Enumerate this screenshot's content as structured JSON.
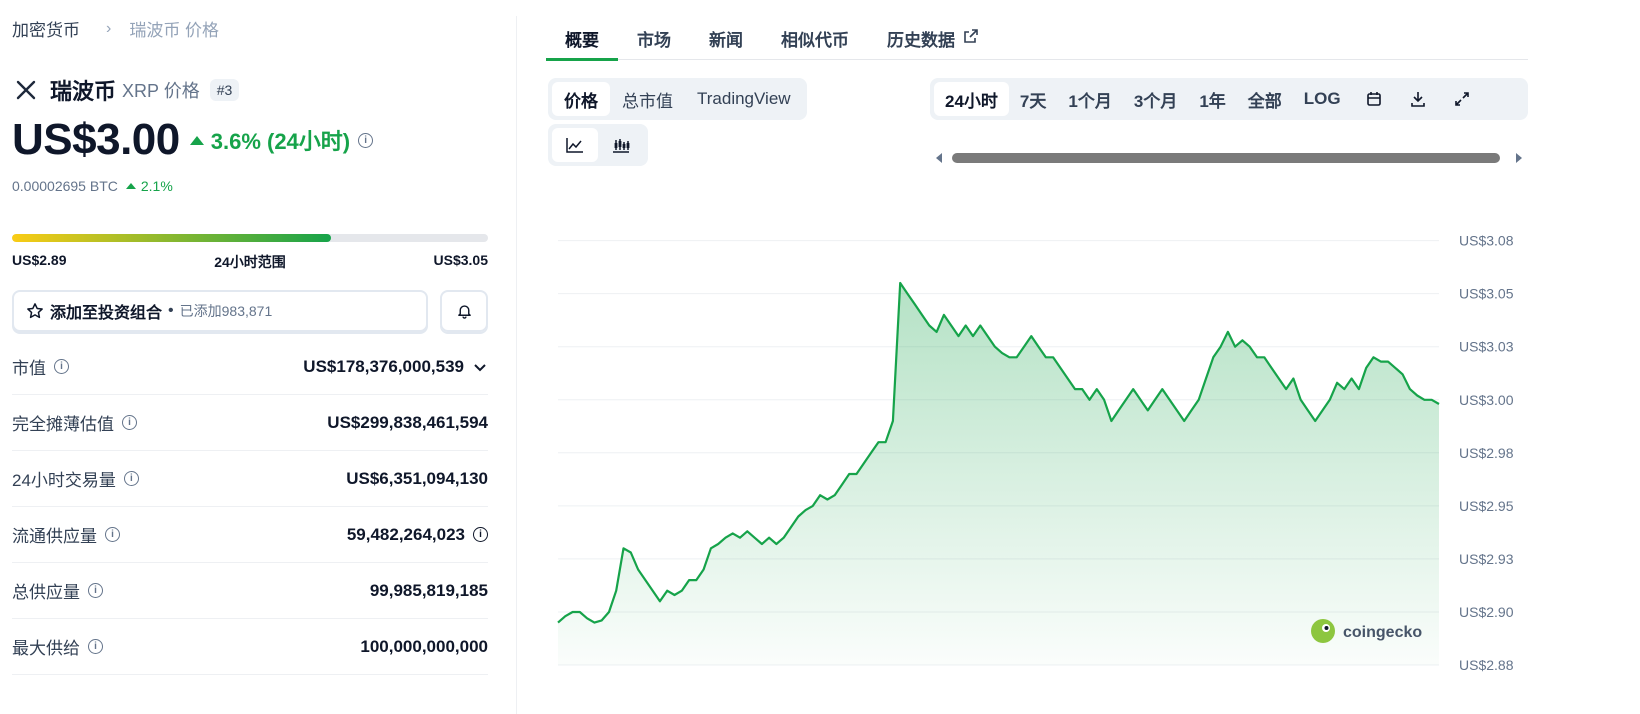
{
  "breadcrumb": {
    "parent": "加密货币",
    "current": "瑞波币 价格"
  },
  "coin": {
    "name": "瑞波币",
    "symbol": "XRP 价格",
    "rank": "#3"
  },
  "price": {
    "value": "US$3.00",
    "change": "3.6% (24小时)",
    "btc": "0.00002695 BTC",
    "btc_change": "2.1%"
  },
  "range": {
    "low": "US$2.89",
    "label": "24小时范围",
    "high": "US$3.05",
    "position_fraction": 0.67
  },
  "portfolio": {
    "label": "添加至投资组合",
    "dot": "•",
    "count": "已添加983,871"
  },
  "stats": [
    {
      "key": "市值",
      "value": "US$178,376,000,539"
    },
    {
      "key": "完全摊薄估值",
      "value": "US$299,838,461,594"
    },
    {
      "key": "24小时交易量",
      "value": "US$6,351,094,130"
    },
    {
      "key": "流通供应量",
      "value": "59,482,264,023"
    },
    {
      "key": "总供应量",
      "value": "99,985,819,185"
    },
    {
      "key": "最大供给",
      "value": "100,000,000,000"
    }
  ],
  "tabs": [
    "概要",
    "市场",
    "新闻",
    "相似代币",
    "历史数据"
  ],
  "chart_type_tabs": [
    "价格",
    "总市值",
    "TradingView"
  ],
  "time_ranges": [
    "24小时",
    "7天",
    "1个月",
    "3个月",
    "1年",
    "全部",
    "LOG"
  ],
  "colors": {
    "accent": "#16a34a",
    "range_start": "#facc15"
  },
  "chart_data": {
    "type": "area",
    "title": "",
    "xlabel": "",
    "ylabel": "",
    "y_ticks": [
      "US$3.08",
      "US$3.05",
      "US$3.03",
      "US$3.00",
      "US$2.98",
      "US$2.95",
      "US$2.93",
      "US$2.90",
      "US$2.88"
    ],
    "ylim": [
      2.875,
      3.08
    ],
    "grid": true,
    "brand": "coingecko",
    "series": [
      {
        "values": [
          2.895,
          2.898,
          2.9,
          2.9,
          2.897,
          2.895,
          2.896,
          2.9,
          2.91,
          2.93,
          2.928,
          2.92,
          2.915,
          2.91,
          2.905,
          2.91,
          2.908,
          2.91,
          2.915,
          2.915,
          2.92,
          2.93,
          2.932,
          2.935,
          2.937,
          2.935,
          2.938,
          2.935,
          2.932,
          2.935,
          2.932,
          2.935,
          2.94,
          2.945,
          2.948,
          2.95,
          2.955,
          2.953,
          2.955,
          2.96,
          2.965,
          2.965,
          2.97,
          2.975,
          2.98,
          2.98,
          2.99,
          3.055,
          3.05,
          3.045,
          3.04,
          3.035,
          3.032,
          3.04,
          3.035,
          3.03,
          3.035,
          3.03,
          3.035,
          3.03,
          3.025,
          3.022,
          3.02,
          3.02,
          3.025,
          3.03,
          3.025,
          3.02,
          3.02,
          3.015,
          3.01,
          3.005,
          3.005,
          3.0,
          3.005,
          3.0,
          2.99,
          2.995,
          3.0,
          3.005,
          3.0,
          2.995,
          3.0,
          3.005,
          3.0,
          2.995,
          2.99,
          2.995,
          3.0,
          3.01,
          3.02,
          3.025,
          3.032,
          3.025,
          3.028,
          3.025,
          3.02,
          3.02,
          3.015,
          3.01,
          3.005,
          3.01,
          3.0,
          2.995,
          2.99,
          2.995,
          3.0,
          3.008,
          3.005,
          3.01,
          3.005,
          3.015,
          3.02,
          3.018,
          3.018,
          3.015,
          3.012,
          3.005,
          3.002,
          3.0,
          3.0,
          2.998
        ]
      }
    ]
  }
}
